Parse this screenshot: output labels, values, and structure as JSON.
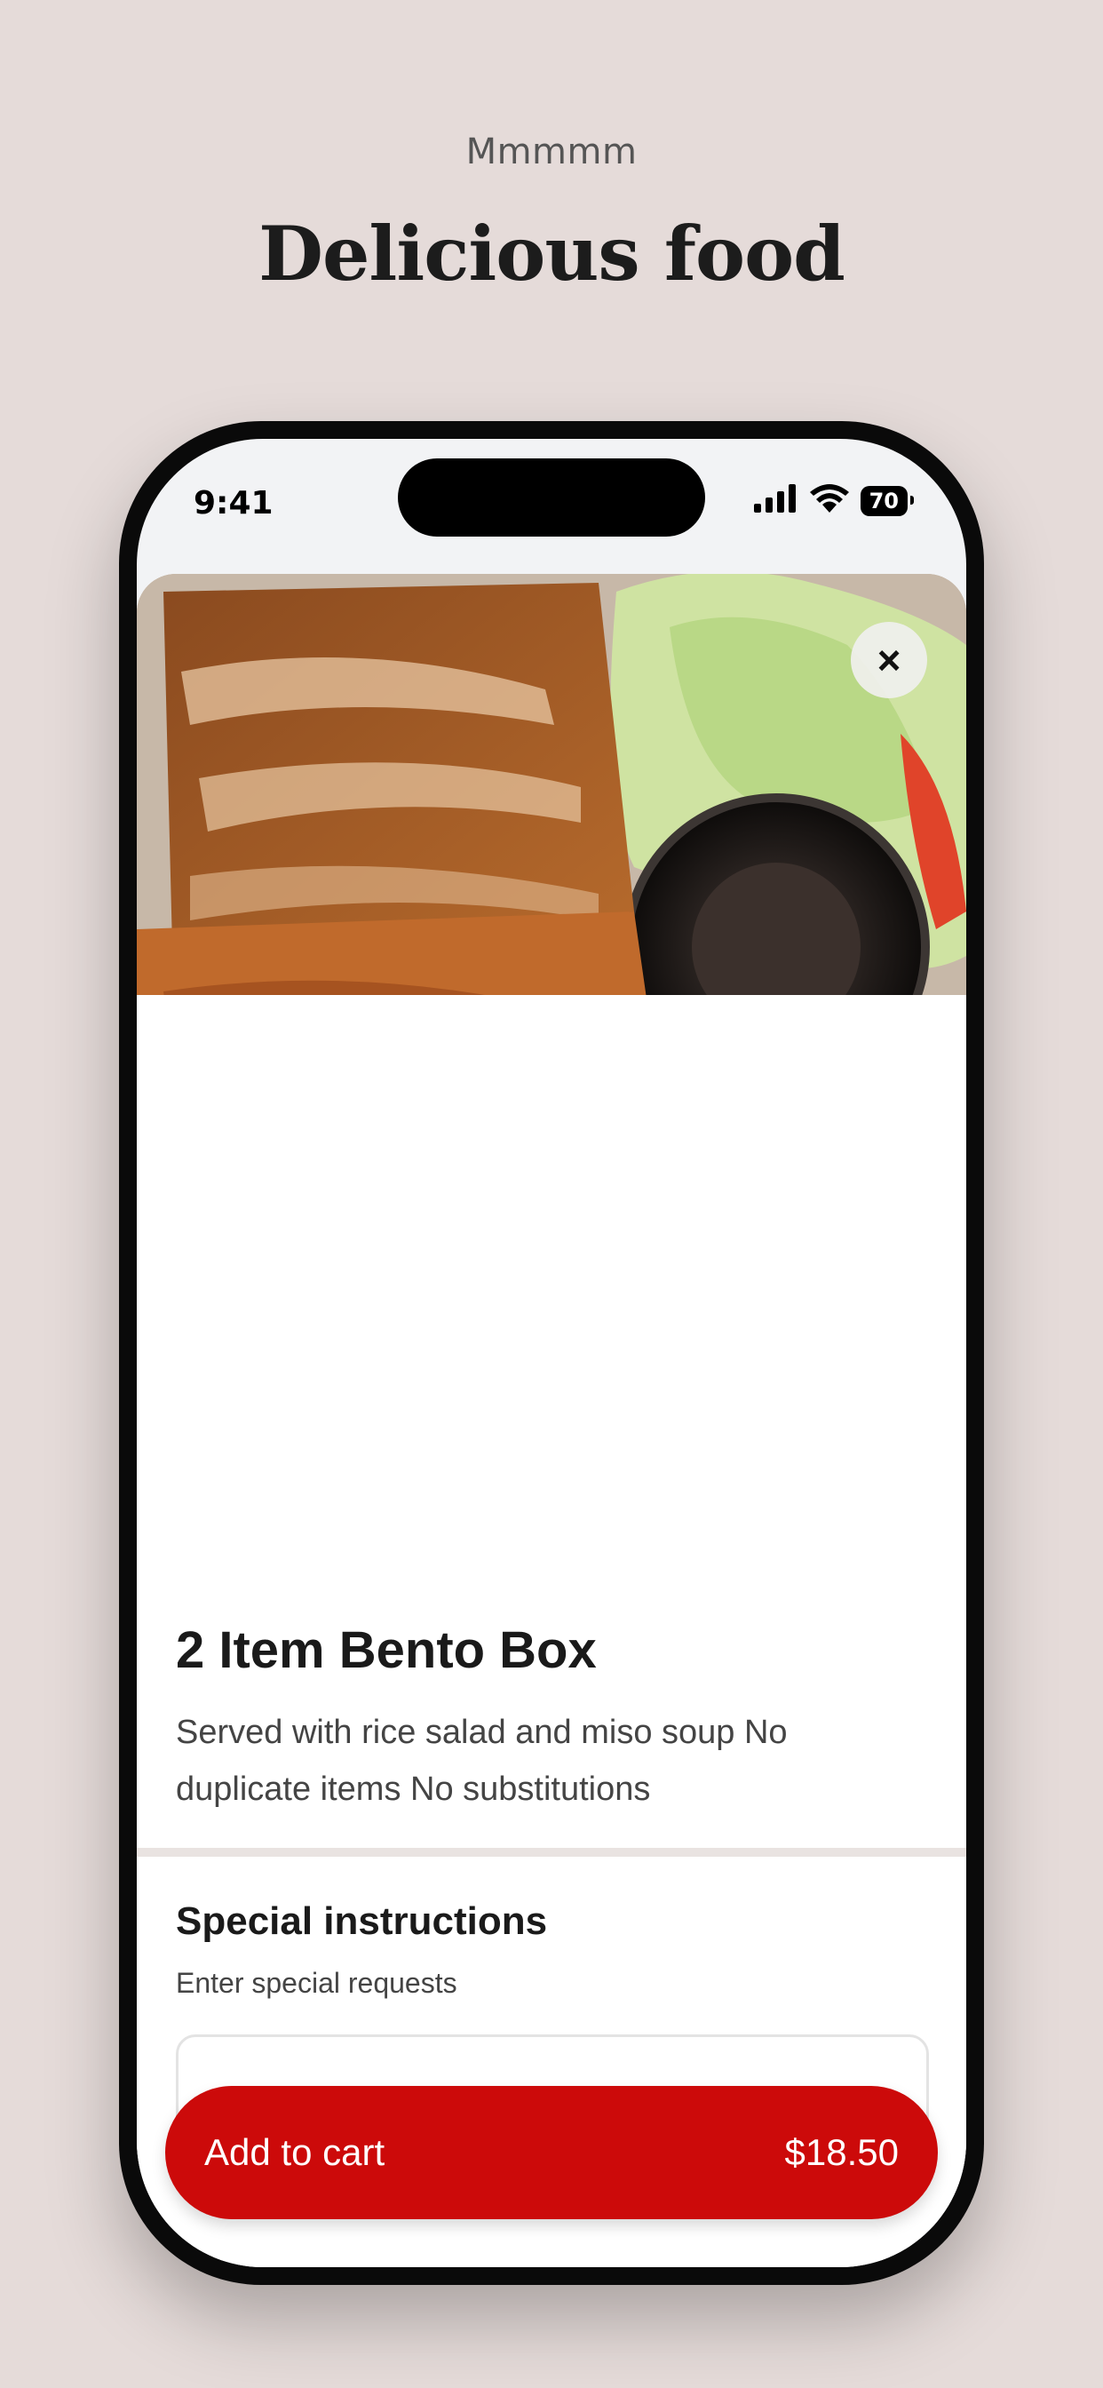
{
  "header": {
    "kicker": "Mmmmm",
    "headline": "Delicious food"
  },
  "status_bar": {
    "time": "9:41",
    "battery": "70"
  },
  "product": {
    "title": "2 Item Bento Box",
    "description": "Served with rice salad and miso soup No duplicate items No substitutions",
    "image_alt": "Chicken katsu and teriyaki bento with rice, salad and sauce cup"
  },
  "special_instructions": {
    "title": "Special instructions",
    "subtitle": "Enter special requests",
    "value": ""
  },
  "cart": {
    "label": "Add to cart",
    "price": "$18.50"
  },
  "colors": {
    "accent": "#cc0a0a",
    "background": "#e5dbd9"
  }
}
